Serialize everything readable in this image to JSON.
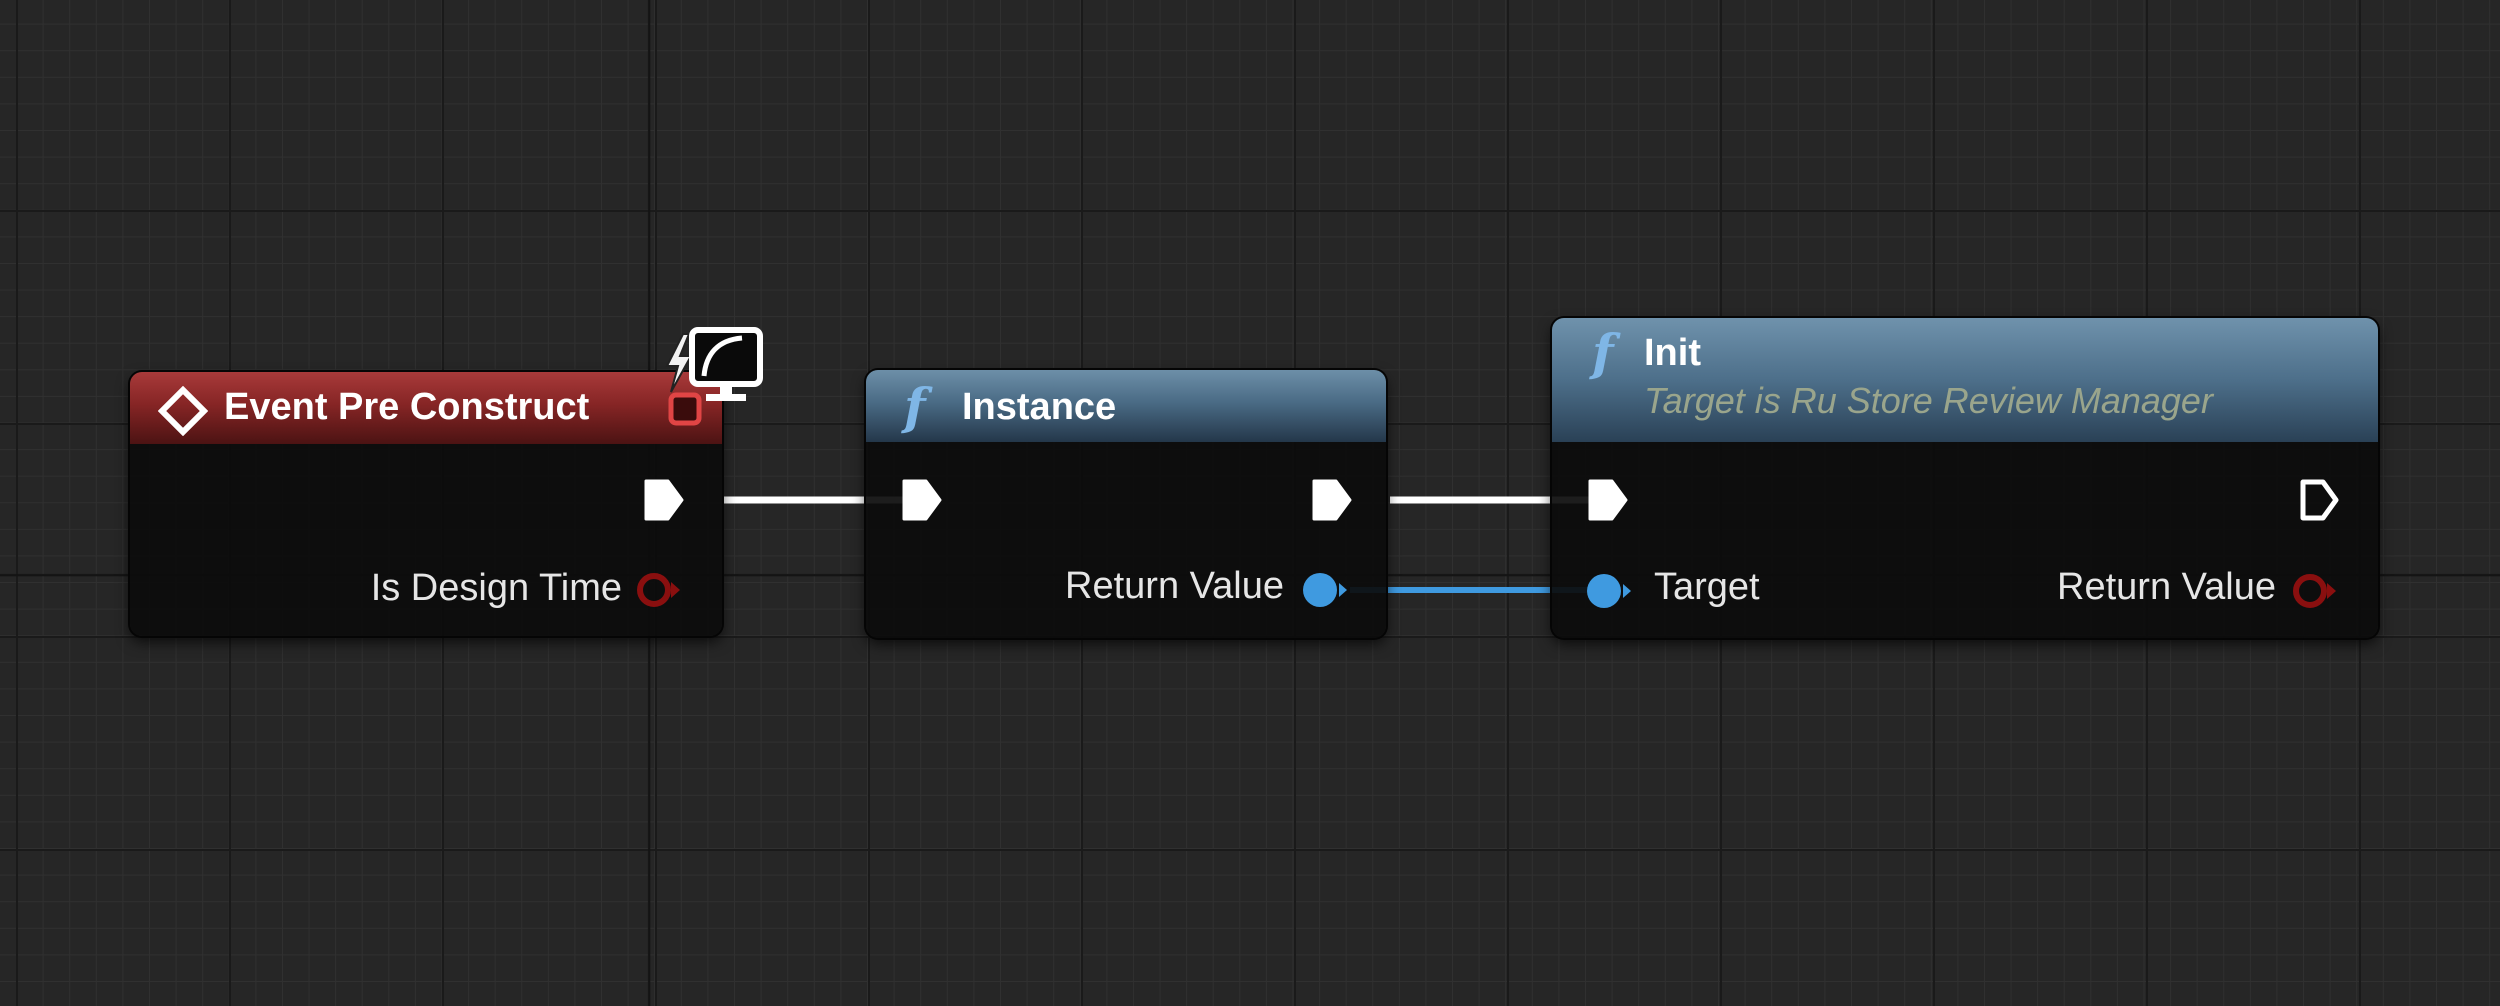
{
  "graph": {
    "nodes": {
      "event_pre_construct": {
        "title": "Event Pre Construct",
        "outputs": {
          "design_time_label": "Is Design Time"
        }
      },
      "instance": {
        "title": "Instance",
        "glyph": "f",
        "outputs": {
          "return_value_label": "Return Value"
        }
      },
      "init": {
        "title": "Init",
        "glyph": "f",
        "subtitle": "Target is Ru Store Review Manager",
        "inputs": {
          "target_label": "Target"
        },
        "outputs": {
          "return_value_label": "Return Value"
        }
      }
    },
    "badges": [
      "lightning-icon",
      "monitor-icon"
    ],
    "icons": [
      "event-diamond-icon",
      "function-f-icon",
      "exec-pin-icon",
      "data-pin-icon"
    ]
  },
  "colors": {
    "background": "#262626",
    "event_header": "#862525",
    "function_header": "#4a6b85",
    "exec_wire": "#ffffff",
    "object_pin": "#3f9ae0",
    "bool_pin": "#8a0f0f",
    "subtitle": "#9aa58c"
  }
}
